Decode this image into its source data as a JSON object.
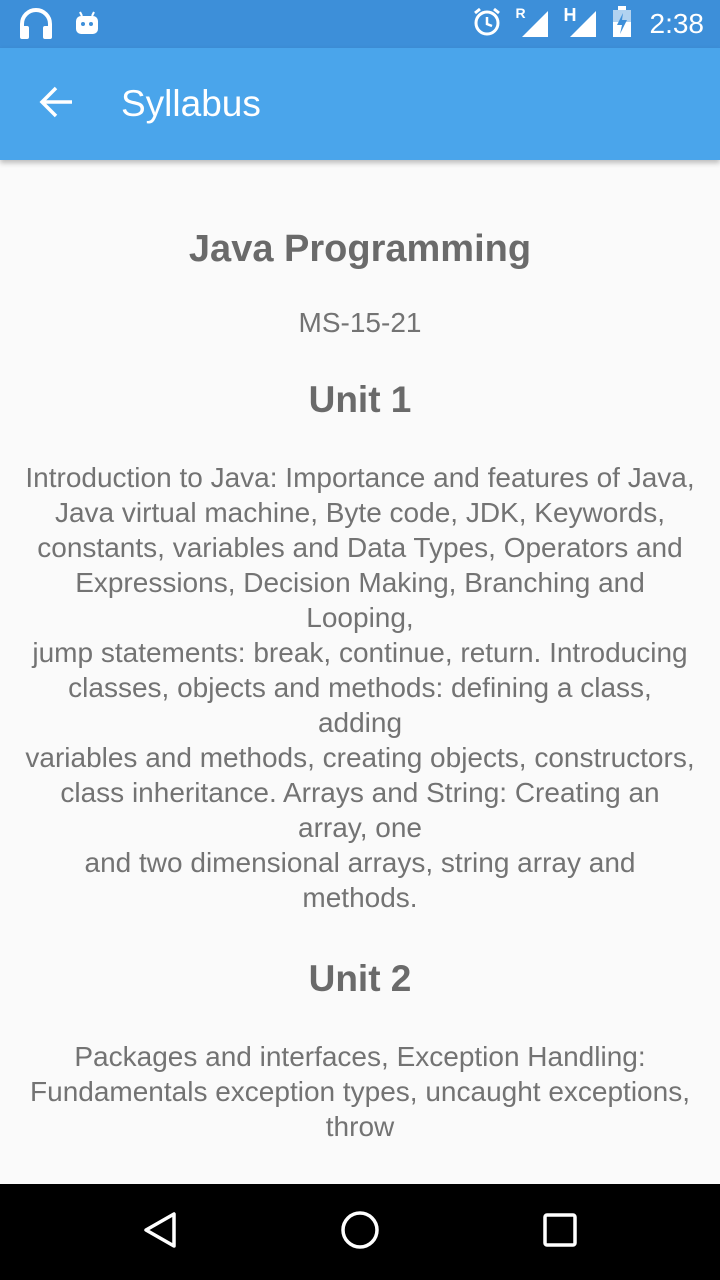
{
  "status_bar": {
    "time": "2:38",
    "left_icons": [
      "headphones-icon",
      "android-icon"
    ],
    "right_icons": [
      "alarm-icon",
      "signal-roaming-icon",
      "h-network-icon",
      "signal-icon",
      "battery-charging-icon"
    ],
    "network_letter_r": "R",
    "network_letter_h": "H"
  },
  "app_bar": {
    "title": "Syllabus",
    "back_icon": "arrow-back-icon",
    "color": "#4aa5eb"
  },
  "content": {
    "course_title": "Java Programming",
    "course_code": "MS-15-21",
    "units": [
      {
        "title": "Unit 1",
        "body": "Introduction to Java: Importance and features of Java, Java virtual machine, Byte code, JDK, Keywords,\nconstants, variables and Data Types, Operators and Expressions, Decision Making, Branching and Looping,\njump statements: break, continue, return. Introducing classes, objects and methods: defining a class, adding\nvariables and methods, creating objects, constructors, class inheritance. Arrays and String: Creating an array, one\nand two dimensional arrays, string array and methods."
      },
      {
        "title": "Unit 2",
        "body": "Packages and interfaces, Exception Handling: Fundamentals exception types, uncaught exceptions, throw"
      }
    ]
  },
  "nav_bar": {
    "icons": [
      "nav-back-icon",
      "nav-home-icon",
      "nav-recents-icon"
    ]
  }
}
